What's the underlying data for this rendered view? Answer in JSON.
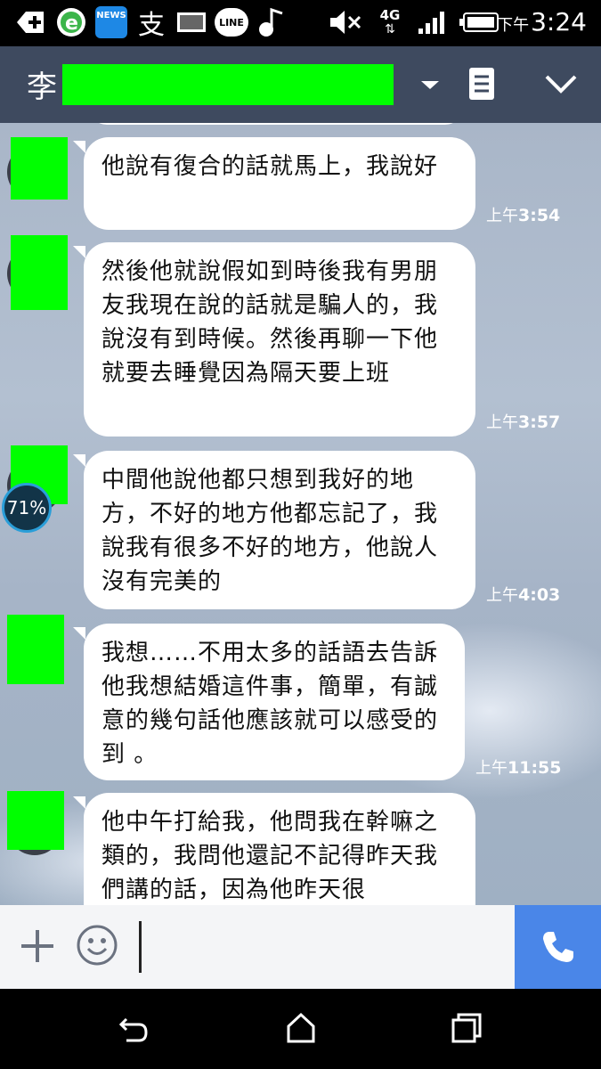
{
  "status_bar": {
    "time": "3:24",
    "ampm": "下午",
    "network": "4G",
    "icons": [
      "add-icon",
      "ie-browser-icon",
      "news-app-icon",
      "alipay-icon",
      "gallery-icon",
      "line-app-icon",
      "music-icon",
      "mute-icon",
      "4g-icon",
      "signal-icon",
      "battery-icon"
    ],
    "news_label": "NEWS",
    "alipay_glyph": "支",
    "line_label": "LINE"
  },
  "header": {
    "contact_name_prefix": "李",
    "icons": [
      "chevron-down-icon",
      "notes-icon",
      "collapse-icon"
    ]
  },
  "messages": [
    {
      "text": "他說有復合的話就馬上，我說好",
      "time_ampm": "上午",
      "time": "3:54"
    },
    {
      "text": "然後他就說假如到時後我有男朋友我現在說的話就是騙人的，我說沒有到時候。然後再聊一下他就要去睡覺因為隔天要上班",
      "time_ampm": "上午",
      "time": "3:57"
    },
    {
      "text": "中間他說他都只想到我好的地方，不好的地方他都忘記了，我說我有很多不好的地方，他說人沒有完美的",
      "time_ampm": "上午",
      "time": "4:03"
    },
    {
      "text": "我想……不用太多的話語去告訴他我想結婚這件事，簡單，有誠意的幾句話他應該就可以感受的到 。",
      "time_ampm": "上午",
      "time": "11:55"
    },
    {
      "text": "他中午打給我，他問我在幹嘛之類的，我問他還記不記得昨天我們講的話，因為他昨天很",
      "time_ampm": "",
      "time": ""
    }
  ],
  "overlay": {
    "battery_percent": "71%"
  },
  "input_bar": {
    "placeholder": "",
    "icons": [
      "plus-icon",
      "emoji-icon",
      "phone-icon"
    ]
  },
  "nav_bar": {
    "icons": [
      "back-icon",
      "home-icon",
      "recent-apps-icon"
    ]
  }
}
